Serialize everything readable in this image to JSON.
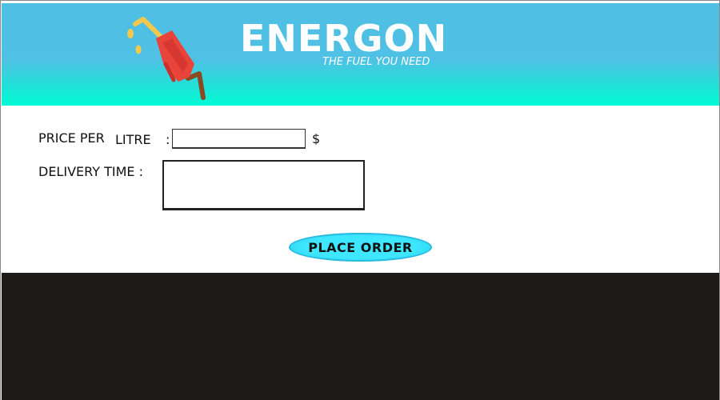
{
  "header": {
    "brand_title": "ENERGON",
    "tagline": "THE FUEL YOU NEED",
    "logo_icon": "fuel-pump-nozzle-icon",
    "colors": {
      "gradient_top": "#4fbfe3",
      "gradient_bottom": "#00fbd5"
    }
  },
  "form": {
    "price_label": "PRICE PER",
    "price_label_unit": "LITRE",
    "price_colon": ":",
    "price_value": "",
    "currency": "$",
    "delivery_label": "DELIVERY TIME :",
    "delivery_value": ""
  },
  "actions": {
    "place_order_label": "PLACE ORDER",
    "button_color": "#3ee7ff"
  },
  "footer": {
    "color": "#1e1c1b"
  }
}
